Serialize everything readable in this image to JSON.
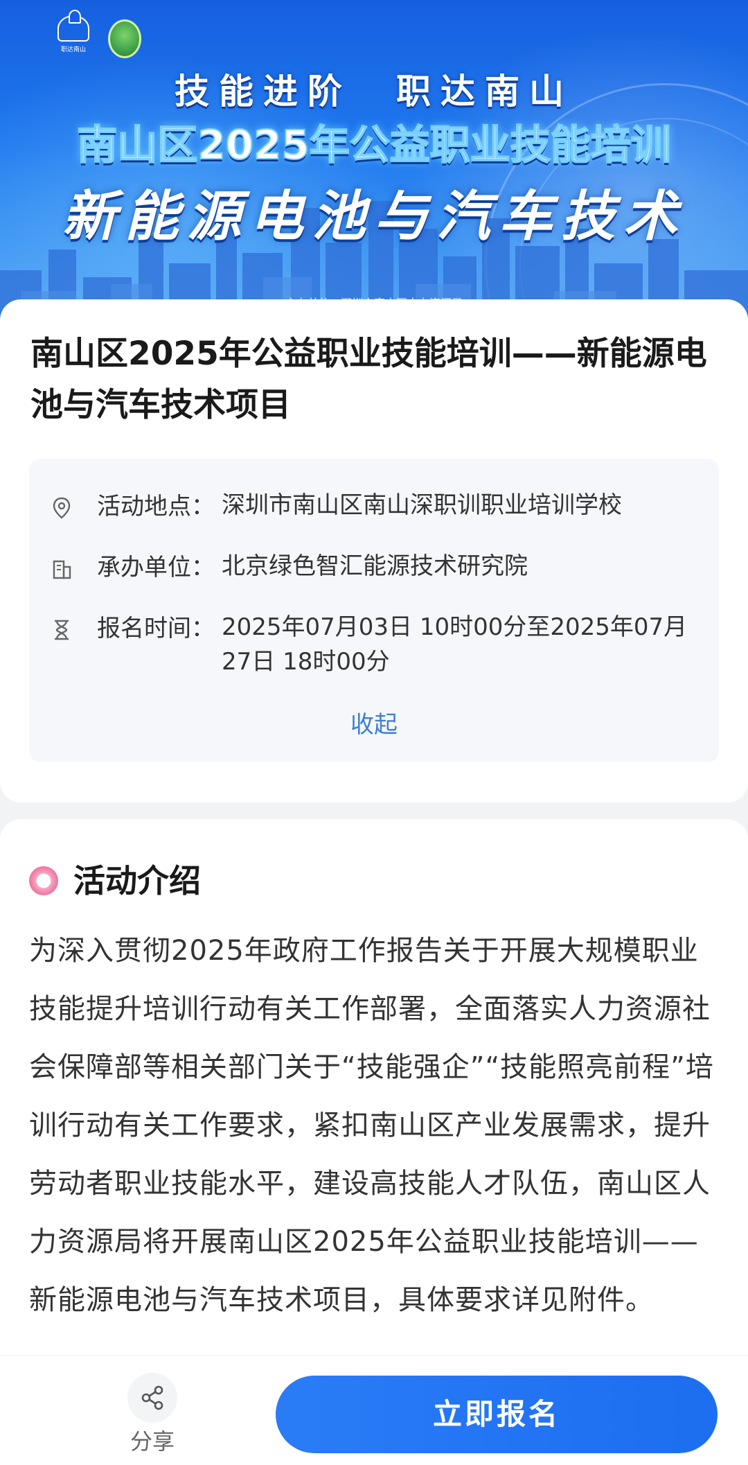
{
  "banner": {
    "logo_caption": "职达南山",
    "slogan": "技能进阶　职达南山",
    "title": "南山区2025年公益职业技能培训",
    "subtitle": "新能源电池与汽车技术",
    "organizer_line": "主办单位：深圳市南山区人力资源局"
  },
  "project": {
    "title": "南山区2025年公益职业技能培训——新能源电池与汽车技术项目"
  },
  "info": {
    "location": {
      "label": "活动地点：",
      "value": "深圳市南山区南山深职训职业培训学校",
      "icon": "location-pin-icon"
    },
    "organizer": {
      "label": "承办单位：",
      "value": "北京绿色智汇能源技术研究院",
      "icon": "building-icon"
    },
    "signup_time": {
      "label": "报名时间：",
      "value": "2025年07月03日 10时00分至2025年07月27日 18时00分",
      "icon": "hourglass-icon"
    },
    "collapse_label": "收起"
  },
  "intro": {
    "heading": "活动介绍",
    "text": "为深入贯彻2025年政府工作报告关于开展大规模职业技能提升培训行动有关工作部署，全面落实人力资源社会保障部等相关部门关于“技能强企”“技能照亮前程”培训行动有关工作要求，紧扣南山区产业发展需求，提升劳动者职业技能水平，建设高技能人才队伍，南山区人力资源局将开展南山区2025年公益职业技能培训——新能源电池与汽车技术项目，具体要求详见附件。"
  },
  "bottom_bar": {
    "share_label": "分享",
    "share_icon": "share-icon",
    "apply_label": "立即报名"
  },
  "colors": {
    "primary": "#1d6ef0",
    "link": "#3d7fcf",
    "accent_pink": "#e8457f",
    "page_bg": "#f2f3f5"
  }
}
